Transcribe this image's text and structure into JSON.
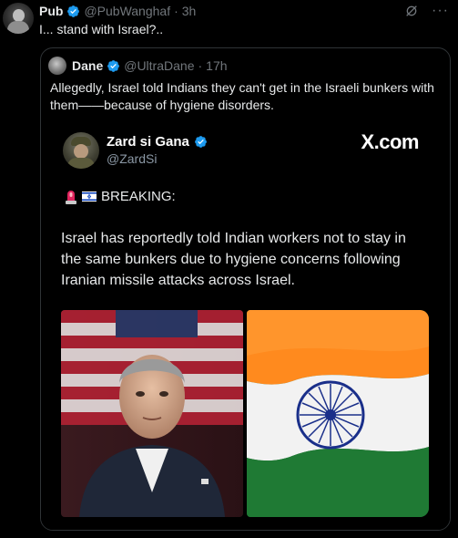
{
  "post": {
    "author_name": "Pub",
    "handle": "@PubWanghaf",
    "separator": "·",
    "time": "3h",
    "more": "···",
    "text": "I... stand with Israel?.."
  },
  "quote": {
    "author_name": "Dane",
    "handle": "@UltraDane",
    "separator": "·",
    "time": "17h",
    "text": "Allegedly, Israel told Indians they can't get in the Israeli bunkers with them——because of hygiene disorders."
  },
  "media": {
    "author_name": "Zard si Gana",
    "handle": "@ZardSi",
    "brand": "X.com",
    "breaking_label": "BREAKING:",
    "headline": "Israel has reportedly told Indian workers not to stay in the same bunkers due to hygiene concerns following Iranian missile attacks across Israel.",
    "icons": [
      "siren-icon",
      "israel-flag-icon"
    ]
  },
  "colors": {
    "verified": "#1d9bf0",
    "background": "#000000",
    "muted": "#71767b",
    "border": "#2f3336"
  }
}
